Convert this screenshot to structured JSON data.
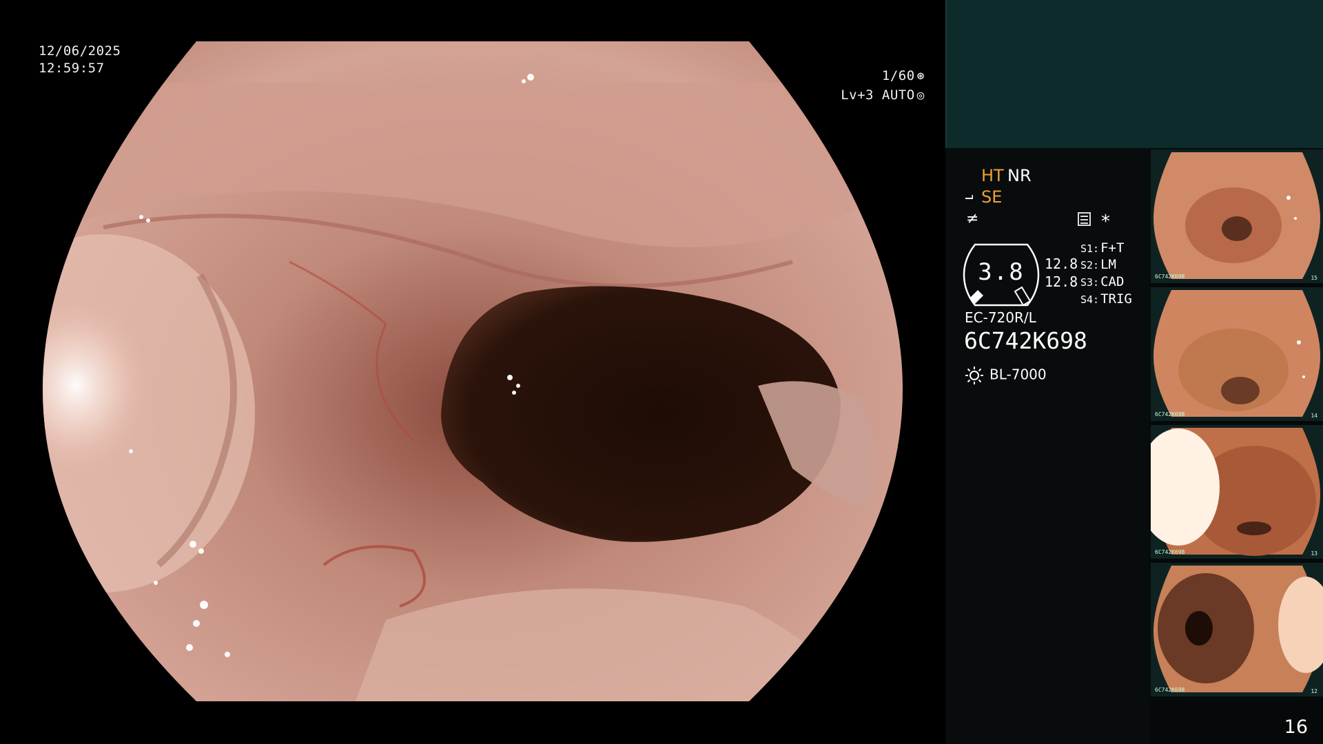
{
  "overlay": {
    "date": "12/06/2025",
    "time": "12:59:57",
    "shutter": "1/60",
    "level": "Lv+3 AUTO"
  },
  "panel": {
    "ht": "HT",
    "nr": "NR",
    "se": "SE",
    "gauge_value": "3.8",
    "value_1": "12.8",
    "value_2": "12.8",
    "settings": [
      {
        "key": "S1:",
        "value": "F+T"
      },
      {
        "key": "S2:",
        "value": "LM"
      },
      {
        "key": "S3:",
        "value": "CAD"
      },
      {
        "key": "S4:",
        "value": "TRIG"
      }
    ],
    "model": "EC-720R/L",
    "serial": "6C742K698",
    "light_source": "BL-7000",
    "page_number": "16"
  },
  "thumbnails": [
    {
      "serial": "6C742K698",
      "index": "15"
    },
    {
      "serial": "6C742K698",
      "index": "14"
    },
    {
      "serial": "6C742K698",
      "index": "13"
    },
    {
      "serial": "6C742K698",
      "index": "12"
    }
  ],
  "colors": {
    "accent_orange": "#f0a030",
    "panel_teal": "#0e2b2b",
    "tissue": "#c98a78",
    "lumen": "#1a0b06"
  },
  "icons": [
    "shutter-icon",
    "auto-iris-icon",
    "se-icon",
    "enhance-icon",
    "menu-icon",
    "star-icon",
    "light-source-icon"
  ]
}
